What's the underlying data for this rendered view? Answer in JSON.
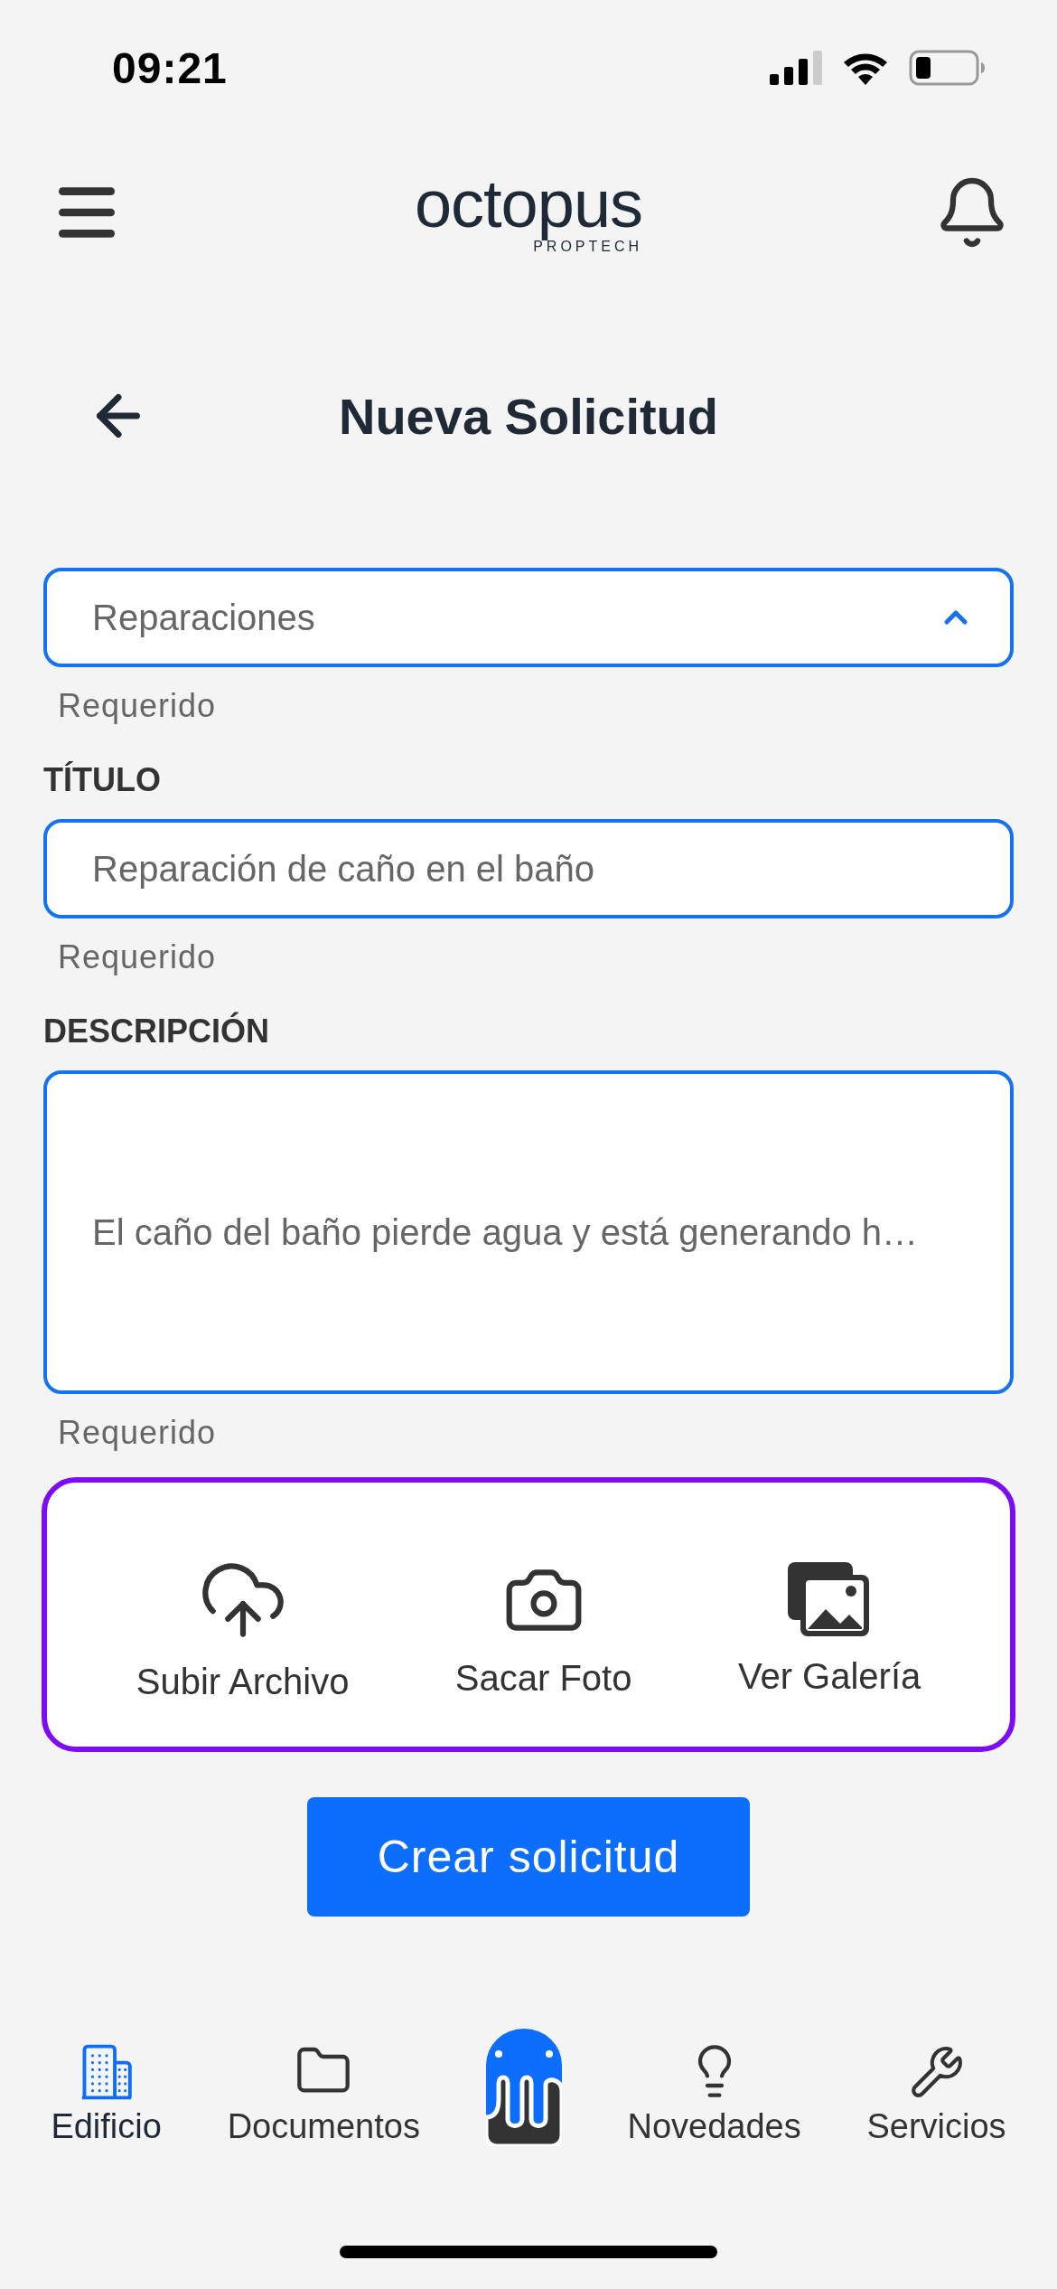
{
  "status_bar": {
    "time": "09:21"
  },
  "header": {
    "logo": "octopus",
    "logo_sub": "PROPTECH"
  },
  "page": {
    "title": "Nueva Solicitud"
  },
  "form": {
    "category": {
      "value": "Reparaciones",
      "expanded": true,
      "hint": "Requerido"
    },
    "title": {
      "label": "TÍTULO",
      "value": "Reparación de caño en el baño",
      "hint": "Requerido"
    },
    "description": {
      "label": "DESCRIPCIÓN",
      "value": "El caño del baño pierde agua y está generando h…",
      "hint": "Requerido"
    }
  },
  "attachments": [
    {
      "kind": "upload",
      "label": "Subir Archivo"
    },
    {
      "kind": "camera",
      "label": "Sacar Foto"
    },
    {
      "kind": "gallery",
      "label": "Ver Galería"
    }
  ],
  "submit_button": "Crear solicitud",
  "bottom_nav": [
    {
      "kind": "building",
      "label": "Edificio",
      "selected": true
    },
    {
      "kind": "folder",
      "label": "Documentos",
      "selected": false
    },
    {
      "kind": "logo"
    },
    {
      "kind": "bulb",
      "label": "Novedades",
      "selected": false
    },
    {
      "kind": "wrench",
      "label": "Servicios",
      "selected": false
    }
  ]
}
